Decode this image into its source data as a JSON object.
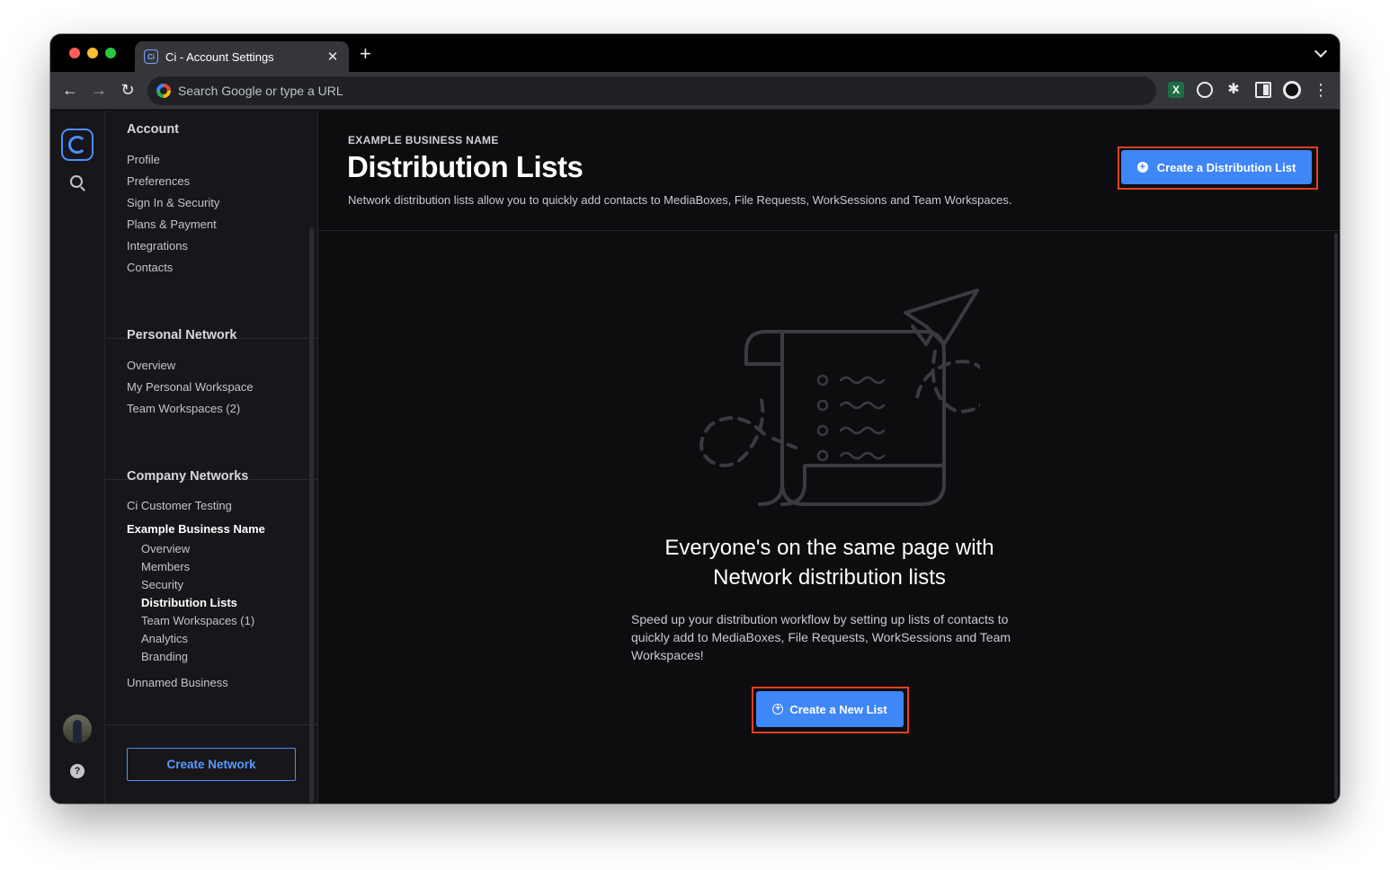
{
  "browser": {
    "tab_title": "Ci - Account Settings",
    "tab_favicon": "Ci",
    "address_placeholder": "Search Google or type a URL"
  },
  "sidebar": {
    "account": {
      "heading": "Account",
      "items": [
        "Profile",
        "Preferences",
        "Sign In & Security",
        "Plans & Payment",
        "Integrations",
        "Contacts"
      ]
    },
    "personal": {
      "heading": "Personal Network",
      "items": [
        "Overview",
        "My Personal Workspace",
        "Team Workspaces (2)"
      ]
    },
    "company": {
      "heading": "Company Networks",
      "network_1": "Ci Customer Testing",
      "network_2": "Example Business Name",
      "sub_items": [
        "Overview",
        "Members",
        "Security",
        "Distribution Lists",
        "Team Workspaces (1)",
        "Analytics",
        "Branding"
      ],
      "active_sub_item": "Distribution Lists",
      "network_3": "Unnamed Business"
    },
    "create_network_label": "Create Network"
  },
  "main": {
    "business_name": "EXAMPLE BUSINESS NAME",
    "title": "Distribution Lists",
    "description": "Network distribution lists allow you to quickly add contacts to MediaBoxes, File Requests, WorkSessions and Team Workspaces.",
    "create_button_label": "Create a Distribution List",
    "empty_title_line1": "Everyone's on the same page with",
    "empty_title_line2": "Network distribution lists",
    "empty_description": "Speed up your distribution workflow by setting up lists of contacts to quickly add to MediaBoxes, File Requests, WorkSessions and Team Workspaces!",
    "new_list_button_label": "Create a New List"
  },
  "colors": {
    "accent": "#3f86f6",
    "highlight": "#e8401c",
    "background": "#0d0d10",
    "sidebar": "#17171b"
  },
  "icons": [
    "back-arrow-icon",
    "forward-arrow-icon",
    "reload-icon",
    "google-icon",
    "excel-icon",
    "grammarly-icon",
    "puzzle-icon",
    "side-panel-icon",
    "profile-icon",
    "kebab-menu-icon",
    "ci-logo-icon",
    "search-icon",
    "help-icon",
    "plus-circle-icon",
    "scroll-paper-plane-illustration"
  ]
}
